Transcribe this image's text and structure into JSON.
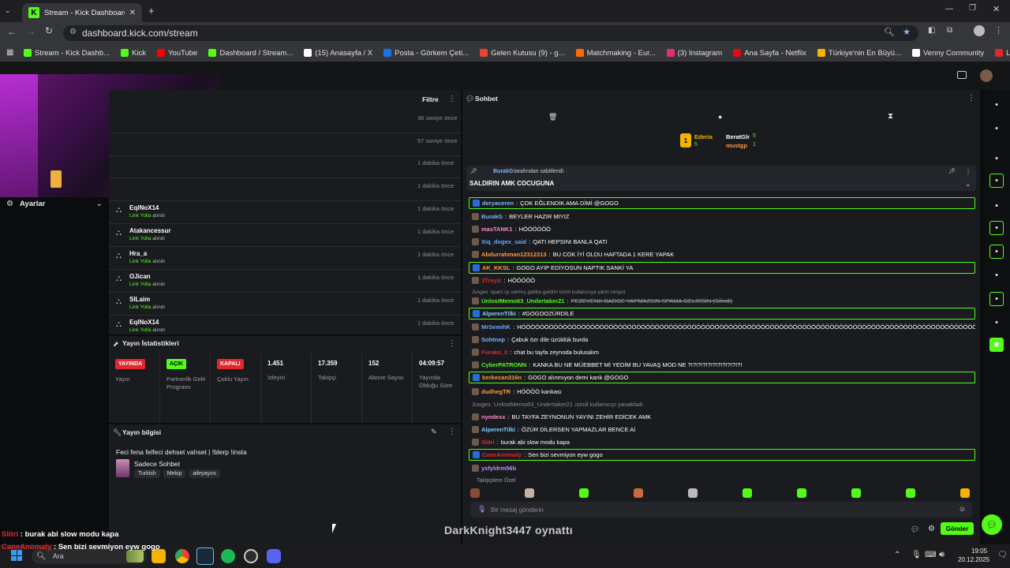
{
  "browser": {
    "tab_title": "Stream - Kick Dashboard",
    "url": "dashboard.kick.com/stream",
    "bookmarks": [
      {
        "label": "Stream - Kick Dashb...",
        "color": "#53fc18"
      },
      {
        "label": "Kick",
        "color": "#53fc18"
      },
      {
        "label": "YouTube",
        "color": "#ff0000"
      },
      {
        "label": "Dashboard / Stream...",
        "color": "#53fc18"
      },
      {
        "label": "(15) Anasayfa / X",
        "color": "#ffffff"
      },
      {
        "label": "Posta - Görkem Çeti...",
        "color": "#1a73e8"
      },
      {
        "label": "Gelen Kutusu (9) - g...",
        "color": "#ea4335"
      },
      {
        "label": "Matchmaking - Eur...",
        "color": "#ff6a00"
      },
      {
        "label": "(3) Instagram",
        "color": "#e1306c"
      },
      {
        "label": "Ana Sayfa - Netflix",
        "color": "#e50914"
      },
      {
        "label": "Türkiye'nin En Büyü...",
        "color": "#f5b301"
      },
      {
        "label": "Venny Community",
        "color": "#ffffff"
      },
      {
        "label": "Lifeinvader - VennyV",
        "color": "#e0282e"
      }
    ]
  },
  "left": {
    "settings_label": "Ayarlar",
    "filter_label": "Filtre",
    "early_times": [
      "36 saniye önce",
      "57 saniye önce",
      "1 dakika önce",
      "1 dakika önce"
    ],
    "activity": [
      {
        "user": "EqlNoX14",
        "action": "Link Yolla",
        "suffix": "alındı",
        "time": "1 dakika önce"
      },
      {
        "user": "Atakancessur",
        "action": "Link Yolla",
        "suffix": "alındı",
        "time": "1 dakika önce"
      },
      {
        "user": "Hra_a",
        "action": "Link Yolla",
        "suffix": "alındı",
        "time": "1 dakika önce"
      },
      {
        "user": "OJican",
        "action": "Link Yolla",
        "suffix": "alındı",
        "time": "1 dakika önce"
      },
      {
        "user": "SlLaim",
        "action": "Link Yolla",
        "suffix": "alındı",
        "time": "1 dakika önce"
      },
      {
        "user": "EqlNoX14",
        "action": "Link Yolla",
        "suffix": "alındı",
        "time": "1 dakika önce"
      }
    ],
    "stats_title": "Yayın İstatistikleri",
    "stats": [
      {
        "value": "YAYINDA",
        "kind": "red",
        "label": "Yayın"
      },
      {
        "value": "AÇIK",
        "kind": "green",
        "label": "Partnerlik Gelir Programı"
      },
      {
        "value": "KAPALI",
        "kind": "red",
        "label": "Çoklu Yayın"
      },
      {
        "value": "1.451",
        "kind": "text",
        "label": "İzleyici"
      },
      {
        "value": "17.359",
        "kind": "text",
        "label": "Takipçi"
      },
      {
        "value": "152",
        "kind": "text",
        "label": "Abone Sayısı"
      },
      {
        "value": "04:09:57",
        "kind": "text",
        "label": "Yayında Olduğu Süre"
      }
    ],
    "info_title": "Yayın bilgisi",
    "stream_title": "Feci fena felfeci dehset vahset | !blerp !insta",
    "category": "Sadece Sohbet",
    "tags": [
      "Turkish",
      "Mekip",
      "aileyayını"
    ]
  },
  "chat": {
    "title": "Sohbet",
    "leaderboard": [
      {
        "name": "Ederia",
        "count": "5"
      },
      {
        "name": "BeratGlr",
        "count": "5"
      },
      {
        "name": "mustgp",
        "count": "1"
      }
    ],
    "pinned_by": "BurakG",
    "pinned_suffix": "tarafından sabitlendi",
    "pinned_text": "SALDIRIN AMK COCUGUNA",
    "messages": [
      {
        "user": "deryaceren",
        "color": "#7fb3ff",
        "text": "ÇOK EĞLENDİK AMA DİMİ @GOGO",
        "hl": true
      },
      {
        "user": "BurakG",
        "color": "#7fb3ff",
        "text": "BEYLER HAZIR MIYIZ",
        "hl": false
      },
      {
        "user": "masTANK1",
        "color": "#ff8acb",
        "text": "HÖÖÖÖÖÖ",
        "hl": false
      },
      {
        "user": "Xiq_dogex_said",
        "color": "#6aa8ff",
        "text": "QATI HEPSINI BANLA QATI",
        "hl": false
      },
      {
        "user": "Abdurrahman12312313",
        "color": "#ff9a3c",
        "text": "BU COK İYİ OLDU HAFTADA 1 KERE YAPAK",
        "hl": false
      },
      {
        "user": "AK_KKSL",
        "color": "#ff9a3c",
        "text": "GOGO AYIP EDİYOSUN NAPTIK SANKİ YA",
        "hl": true
      },
      {
        "user": "3Treyiz",
        "color": "#e0282e",
        "text": "HÖÖÖÖÖ",
        "hl": false
      },
      {
        "user": "Jusges",
        "color": "#8a8d93",
        "text": "spam işi varmış galiba geldim isimli kullanıcıya yanıt veriyor",
        "hl": false
      },
      {
        "user": "UnlostMemo63_Undertaker21",
        "color": "#53fc18",
        "text": "PEZEVENK BADGE YAPMAZSIN SPAMA GELİRSİN (Silindi)",
        "hl": false
      },
      {
        "user": "AlperenTilki",
        "color": "#7fd0ff",
        "text": "#GOGOOZÜRDİLE",
        "hl": true
      },
      {
        "user": "MrSemihK",
        "color": "#6aa8ff",
        "text": "HÖÖÖÖÖÖÖÖÖÖÖÖÖÖÖÖÖÖÖÖÖÖÖÖÖÖÖÖÖÖÖÖÖÖÖÖÖÖÖÖÖÖÖÖÖÖÖÖÖÖÖÖÖÖÖÖÖÖÖÖÖÖÖÖÖÖÖÖÖÖÖÖÖÖÖÖÖÖÖÖÖÖÖÖÖÖÖÖÖÖÖÖÖÖÖÖÖÖÖÖÖÖÖÖÖÖ",
        "hl": false
      },
      {
        "user": "Sohtnep",
        "color": "#7fb3ff",
        "text": "Çabuk özr dile üzüldük burda",
        "hl": false
      },
      {
        "user": "Furako_0",
        "color": "#e0282e",
        "text": "chat bu tayfa zeynoda bulusalım",
        "hl": false
      },
      {
        "user": "CyberPATRONN",
        "color": "#53fc18",
        "text": "KANKA BU NE MÜEBBET Mİ YEDİM BU YAVAŞ MOD NE ?!?!?!?!?!?!?!?!?!?!?!",
        "hl": false
      },
      {
        "user": "berkecan316n",
        "color": "#ff9a3c",
        "text": "GOGO alınmıyon demi kank @GOGO",
        "hl": true
      },
      {
        "user": "dudhegTR",
        "color": "#ff9a3c",
        "text": "HÖÖÖÖ kankası",
        "hl": false
      },
      {
        "user": "Jusges, UnlostMemo63_Undertaker21",
        "color": "#8a8d93",
        "text": "isimli kullanıcıyı yasakladı",
        "hl": false
      },
      {
        "user": "nyndexx",
        "color": "#ff8acb",
        "text": "BU TAYFA ZEYNONUN YAYINI ZEHİR EDİCEK AMK",
        "hl": false
      },
      {
        "user": "AlperenTilki",
        "color": "#7fd0ff",
        "text": "ÖZÜR DİLERSEN YAPMAZLAR BENCE Aİ",
        "hl": false
      },
      {
        "user": "Slitri",
        "color": "#e0282e",
        "text": "burak abi slow modu kapa",
        "hl": false
      },
      {
        "user": "CaneAnomaly",
        "color": "#e0282e",
        "text": "Sen bizi sevmiyon eyw gogo",
        "hl": true
      },
      {
        "user": "ysfyldrm56b",
        "color": "#c58bff",
        "text": "",
        "hl": false
      }
    ],
    "followers_label": "Takipçilere Özel",
    "input_placeholder": "Bir mesaj gönderin",
    "send_label": "Gönder"
  },
  "overlay": {
    "line1_user": "Slitri",
    "line1_text": "burak abi slow modu kapa",
    "line2_user": "CaneAnomaly",
    "line2_text": "Sen bizi sevmiyon eyw gogo",
    "now_playing": "DarkKnight3447 oynattı"
  },
  "taskbar": {
    "search_label": "Ara",
    "time": "19:05",
    "date": "20.12.2025"
  }
}
